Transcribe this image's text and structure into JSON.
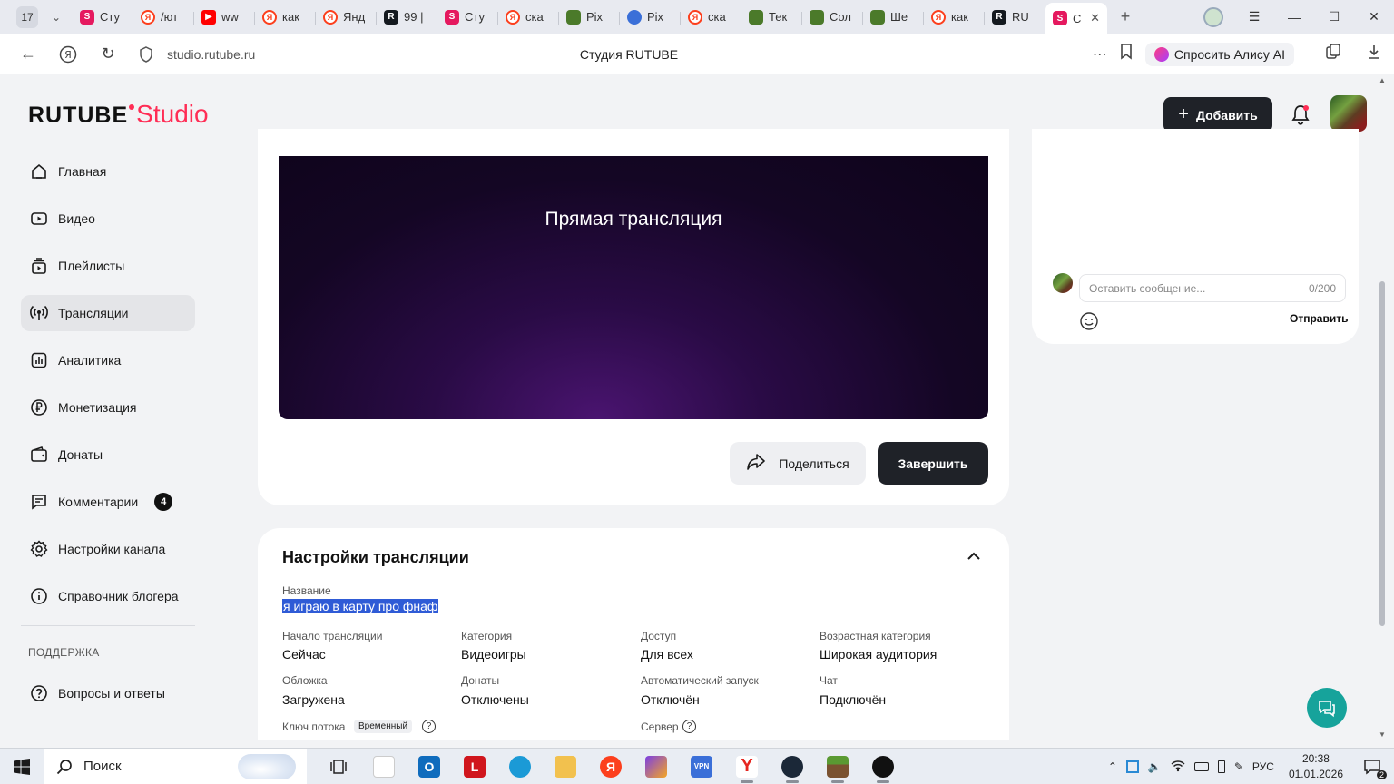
{
  "browser": {
    "tab_count": "17",
    "tabs": [
      {
        "icon": "studio-favicon",
        "label": "Сту"
      },
      {
        "icon": "yandex-favicon",
        "label": "/ют"
      },
      {
        "icon": "youtube-favicon",
        "label": "ww"
      },
      {
        "icon": "yandex-favicon",
        "label": "как"
      },
      {
        "icon": "yandex-favicon",
        "label": "Янд"
      },
      {
        "icon": "rutube-favicon",
        "label": "99 |"
      },
      {
        "icon": "studio-favicon",
        "label": "Сту"
      },
      {
        "icon": "yandex-favicon",
        "label": "ска"
      },
      {
        "icon": "minecraft-favicon",
        "label": "Pix"
      },
      {
        "icon": "pixel-favicon",
        "label": "Pix"
      },
      {
        "icon": "yandex-favicon",
        "label": "ска"
      },
      {
        "icon": "minecraft-favicon",
        "label": "Тек"
      },
      {
        "icon": "minecraft-favicon",
        "label": "Сол"
      },
      {
        "icon": "minecraft-favicon",
        "label": "Ше"
      },
      {
        "icon": "yandex-favicon",
        "label": "как"
      },
      {
        "icon": "rutube-favicon",
        "label": "RU"
      },
      {
        "icon": "studio-favicon",
        "label": "С",
        "active": true
      }
    ],
    "url": "studio.rutube.ru",
    "page_title": "Студия RUTUBE",
    "alice_label": "Спросить Алису AI"
  },
  "header": {
    "logo_main": "RUTUBE",
    "logo_sub": "Studio",
    "add_button": "Добавить"
  },
  "sidebar": {
    "items": [
      {
        "label": "Главная",
        "icon": "home-icon"
      },
      {
        "label": "Видео",
        "icon": "video-icon"
      },
      {
        "label": "Плейлисты",
        "icon": "playlist-icon"
      },
      {
        "label": "Трансляции",
        "icon": "broadcast-icon",
        "active": true
      },
      {
        "label": "Аналитика",
        "icon": "analytics-icon"
      },
      {
        "label": "Монетизация",
        "icon": "ruble-icon"
      },
      {
        "label": "Донаты",
        "icon": "wallet-icon"
      },
      {
        "label": "Комментарии",
        "icon": "comment-icon",
        "badge": "4"
      },
      {
        "label": "Настройки канала",
        "icon": "gear-icon"
      },
      {
        "label": "Справочник блогера",
        "icon": "info-icon"
      }
    ],
    "support_title": "ПОДДЕРЖКА",
    "support_items": [
      {
        "label": "Вопросы и ответы",
        "icon": "question-icon"
      }
    ]
  },
  "player": {
    "title": "Прямая трансляция",
    "share_label": "Поделиться",
    "finish_label": "Завершить"
  },
  "chat": {
    "placeholder": "Оставить сообщение...",
    "counter": "0/200",
    "send_label": "Отправить"
  },
  "settings": {
    "title": "Настройки трансляции",
    "name_label": "Название",
    "name_value": "я играю в карту про фнаф",
    "fields": [
      {
        "label": "Начало трансляции",
        "value": "Сейчас"
      },
      {
        "label": "Категория",
        "value": "Видеоигры"
      },
      {
        "label": "Доступ",
        "value": "Для всех"
      },
      {
        "label": "Возрастная категория",
        "value": "Широкая аудитория"
      },
      {
        "label": "Обложка",
        "value": "Загружена"
      },
      {
        "label": "Донаты",
        "value": "Отключены"
      },
      {
        "label": "Автоматический запуск",
        "value": "Отключён"
      },
      {
        "label": "Чат",
        "value": "Подключён"
      }
    ],
    "stream_key_label": "Ключ потока",
    "stream_key_badge": "Временный",
    "server_label": "Сервер"
  },
  "taskbar": {
    "search_label": "Поиск",
    "lang": "РУС",
    "time": "20:38",
    "date": "01.01.2026",
    "notifications": "2"
  },
  "colors": {
    "accent": "#ff2d55",
    "dark_button": "#1f2228",
    "selection": "#2f5bd6",
    "help_fab": "#16a39b"
  }
}
